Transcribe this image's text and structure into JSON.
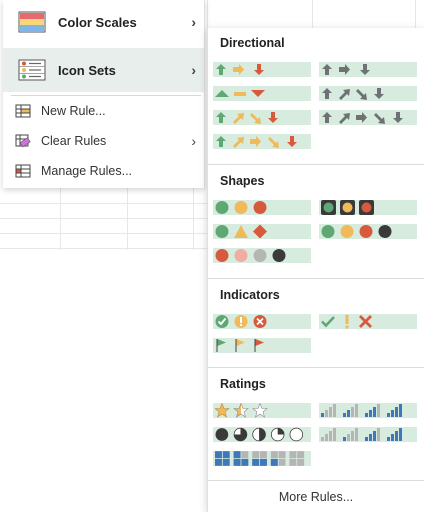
{
  "menu": {
    "color_scales_label": "Color Scales",
    "icon_sets_label": "Icon Sets",
    "new_rule_label": "New Rule...",
    "clear_rules_label": "Clear Rules",
    "manage_rules_label": "Manage Rules...",
    "chevron": "›"
  },
  "submenu": {
    "directional_title": "Directional",
    "shapes_title": "Shapes",
    "indicators_title": "Indicators",
    "ratings_title": "Ratings",
    "more_rules_label": "More Rules..."
  },
  "colors": {
    "green": "#5fa873",
    "yellow": "#f0b95a",
    "red": "#d65a3b",
    "gray": "#6f7274",
    "pink": "#f3aca3",
    "lightgray": "#b5b5b5",
    "black": "#3a3a3a",
    "blue": "#3f78b8",
    "highlight": "#d7ecdf"
  },
  "icon_sets": {
    "directional": [
      "3 Arrows (Colored)",
      "3 Arrows (Gray)",
      "3 Triangles",
      "4 Arrows (Gray)",
      "4 Arrows (Colored)",
      "5 Arrows (Gray)",
      "5 Arrows (Colored)"
    ],
    "shapes": [
      "3 Traffic Lights (Unrimmed)",
      "3 Traffic Lights (Rimmed)",
      "3 Signs",
      "4 Traffic Lights",
      "Red To Black"
    ],
    "indicators": [
      "3 Symbols (Circled)",
      "3 Symbols (Uncircled)",
      "3 Flags"
    ],
    "ratings": [
      "3 Stars",
      "4 Ratings",
      "5 Quarters",
      "5 Ratings",
      "5 Boxes"
    ]
  }
}
